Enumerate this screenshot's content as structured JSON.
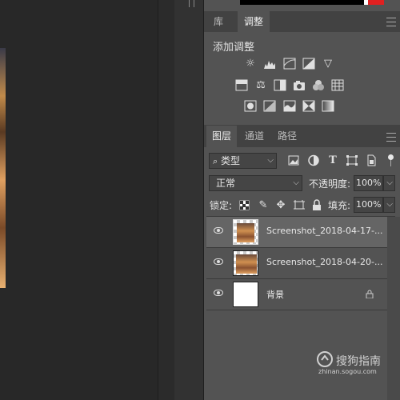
{
  "panel_tabs": {
    "library": "库",
    "adjustments": "调整"
  },
  "adjustments": {
    "heading": "添加调整"
  },
  "layers_tabs": {
    "layers": "图层",
    "channels": "通道",
    "paths": "路径"
  },
  "filter": {
    "label": "类型"
  },
  "blend": {
    "mode": "正常",
    "opacity_label": "不透明度:",
    "opacity_value": "100%"
  },
  "lock": {
    "label": "锁定:",
    "fill_label": "填充:",
    "fill_value": "100%"
  },
  "layers": [
    {
      "name": "Screenshot_2018-04-17-...",
      "selected": true
    },
    {
      "name": "Screenshot_2018-04-20-...",
      "selected": false
    },
    {
      "name": "背景",
      "locked": true
    }
  ],
  "watermark": {
    "brand": "搜狗指南",
    "url": "zhinan.sogou.com"
  },
  "colors": {
    "panel": "#535353",
    "tabbar": "#424242",
    "selected_row": "#656565",
    "accent_red": "#e02020"
  }
}
